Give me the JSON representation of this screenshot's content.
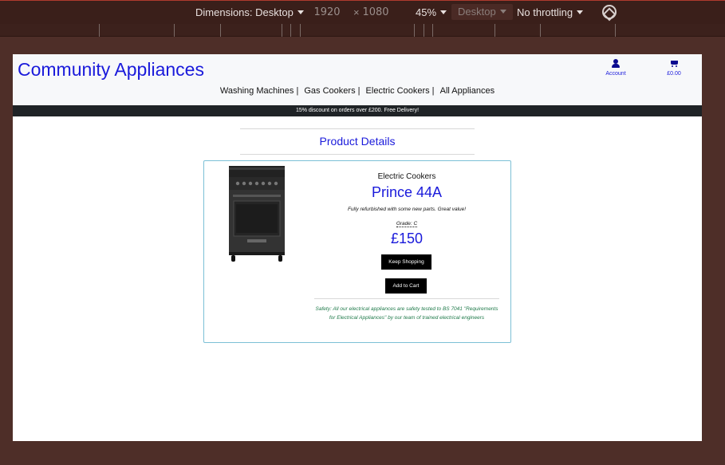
{
  "devtools": {
    "dimensions_label": "Dimensions: Desktop",
    "width_value": "1920",
    "times_sign": "×",
    "height_value": "1080",
    "zoom": "45%",
    "device_type": "Desktop",
    "throttling": "No throttling"
  },
  "header": {
    "brand": "Community Appliances",
    "account_label": "Account",
    "cart_total": "£0.00"
  },
  "nav": {
    "items": [
      "Washing Machines |",
      "Gas Cookers |",
      "Electric Cookers |",
      "All Appliances"
    ]
  },
  "banner": {
    "text": "15% discount on orders over £200. Free Delivery!"
  },
  "page": {
    "title": "Product Details"
  },
  "product": {
    "category": "Electric Cookers",
    "name": "Prince 44A",
    "description": "Fully refurbished with some new parts. Great value!",
    "grade": "Grade: C",
    "price": "£150",
    "keep_shopping_label": "Keep Shopping",
    "add_to_cart_label": "Add to Cart",
    "safety_note": "Safety: All our electrical appliances are safety tested to BS 7041 \"Requirements for Electrical Appliances\" by our team of trained electrical engineers"
  },
  "colors": {
    "brand_blue": "#1a1adb",
    "banner_bg": "#1f2326",
    "card_border": "#7cc0d6",
    "safety_green": "#1f7a4a"
  }
}
